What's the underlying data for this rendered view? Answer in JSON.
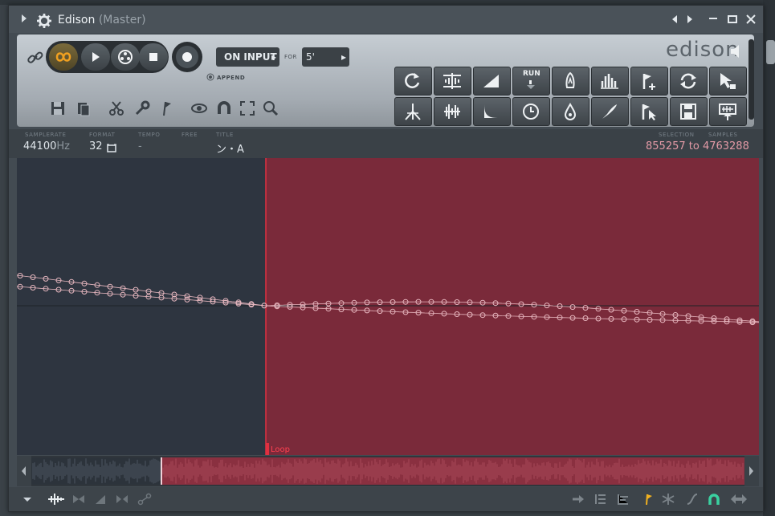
{
  "window": {
    "title": "Edison",
    "subtitle": "(Master)"
  },
  "toolbar": {
    "on_input_label": "ON INPUT",
    "for_label": "FOR",
    "for_value": "5'",
    "append_label": "APPEND",
    "run_label": "RUN",
    "logo": "edison"
  },
  "info": {
    "samplerate_label": "SAMPLERATE",
    "samplerate_value": "44100",
    "samplerate_unit": "Hz",
    "format_label": "FORMAT",
    "format_value": "32",
    "tempo_label": "TEMPO",
    "tempo_value": "-",
    "free_label": "FREE",
    "title_label": "TITLE",
    "title_value": "ン・A",
    "selection_label": "SELECTION",
    "samples_label": "SAMPLES",
    "selection_value": "855257 to 4763288"
  },
  "waveform": {
    "loop_marker_label": "Loop",
    "selection_color": "#7a2a3a",
    "unselected_color": "#2e3540",
    "playhead_color": "#e03040",
    "curve_color": "#e8b8c0"
  },
  "colors": {
    "loop_accent": "#f0a020",
    "magnet_accent": "#3ad0a0"
  }
}
